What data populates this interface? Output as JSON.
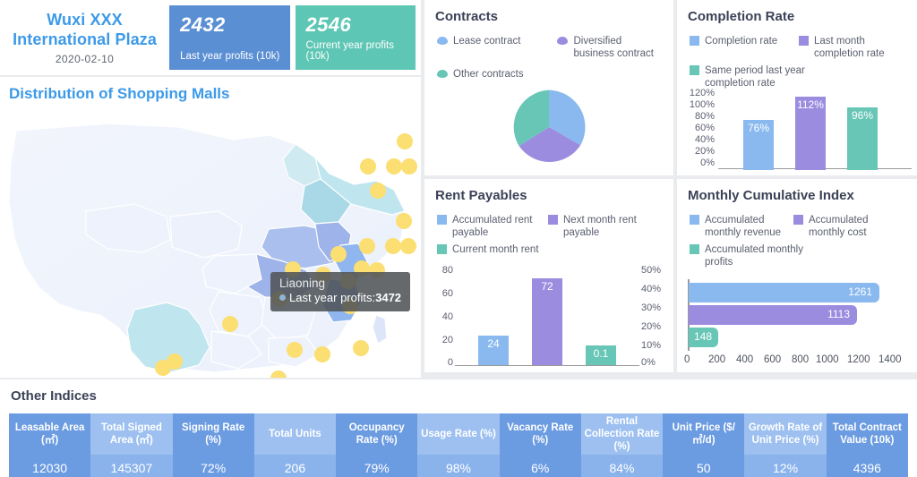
{
  "header": {
    "plaza_name_line1": "Wuxi XXX",
    "plaza_name_line2": "International Plaza",
    "date": "2020-02-10",
    "kpis": [
      {
        "value": "2432",
        "label": "Last year profits (10k)",
        "color": "#5b8fd4"
      },
      {
        "value": "2546",
        "label": "Current year profits (10k)",
        "color": "#5ec6b4"
      }
    ]
  },
  "map": {
    "title": "Distribution of Shopping Malls",
    "tooltip": {
      "region": "Liaoning",
      "metric_label": "Last year profits:",
      "metric_value": "3472"
    }
  },
  "contracts": {
    "title": "Contracts",
    "chart_data": {
      "type": "pie",
      "title": "Contracts",
      "legend_position": "top",
      "labels": [
        "Lease contract",
        "Diversified business contract",
        "Other contracts"
      ],
      "values": [
        34,
        33,
        33
      ],
      "colors": [
        "#89b9ee",
        "#9b8ce0",
        "#68c6b6"
      ]
    }
  },
  "completion": {
    "title": "Completion Rate",
    "chart_data": {
      "type": "bar",
      "title": "Completion Rate",
      "categories": [
        "Completion rate",
        "Last month completion rate",
        "Same period last year completion rate"
      ],
      "values": [
        76,
        112,
        96
      ],
      "value_labels": [
        "76%",
        "112%",
        "96%"
      ],
      "colors": [
        "#89b9ee",
        "#9b8ce0",
        "#68c6b6"
      ],
      "ylim": [
        0,
        120
      ],
      "yticks": [
        "0%",
        "20%",
        "40%",
        "60%",
        "80%",
        "100%",
        "120%"
      ],
      "ylabel": "",
      "xlabel": "",
      "grid": false,
      "legend_position": "top"
    }
  },
  "rent": {
    "title": "Rent Payables",
    "chart_data": {
      "type": "bar",
      "title": "Rent Payables",
      "categories": [
        "Accumulated rent payable",
        "Next month rent payable",
        "Current month rent"
      ],
      "values": [
        24,
        72,
        0.1
      ],
      "value_labels": [
        "24",
        "72",
        "0.1"
      ],
      "colors": [
        "#89b9ee",
        "#9b8ce0",
        "#68c6b6"
      ],
      "ylim": [
        0,
        80
      ],
      "yticks": [
        "0",
        "20",
        "40",
        "60",
        "80"
      ],
      "y2lim": [
        0,
        50
      ],
      "y2ticks": [
        "0%",
        "10%",
        "20%",
        "30%",
        "40%",
        "50%"
      ],
      "ylabel": "",
      "xlabel": "",
      "grid": false,
      "legend_position": "top"
    }
  },
  "monthly": {
    "title": "Monthly Cumulative Index",
    "chart_data": {
      "type": "bar",
      "orientation": "horizontal",
      "title": "Monthly Cumulative Index",
      "categories": [
        "Accumulated monthly revenue",
        "Accumulated monthly cost",
        "Accumulated monthly profits"
      ],
      "values": [
        1261,
        1113,
        148
      ],
      "value_labels": [
        "1261",
        "1113",
        "148"
      ],
      "colors": [
        "#89b9ee",
        "#9b8ce0",
        "#68c6b6"
      ],
      "xlim": [
        0,
        1400
      ],
      "xticks": [
        "0",
        "200",
        "400",
        "600",
        "800",
        "1000",
        "1200",
        "1400"
      ],
      "ylabel": "",
      "xlabel": "",
      "grid": false,
      "legend_position": "top"
    }
  },
  "other_indices": {
    "title": "Other Indices",
    "columns": [
      "Leasable Area (㎡)",
      "Total Signed Area (㎡)",
      "Signing Rate (%)",
      "Total Units",
      "Occupancy Rate (%)",
      "Usage Rate (%)",
      "Vacancy Rate (%)",
      "Rental Collection Rate (%)",
      "Unit Price ($/㎡/d)",
      "Growth Rate of Unit Price (%)",
      "Total Contract Value (10k)"
    ],
    "values": [
      "12030",
      "145307",
      "72%",
      "206",
      "79%",
      "98%",
      "6%",
      "84%",
      "50",
      "12%",
      "4396"
    ]
  }
}
